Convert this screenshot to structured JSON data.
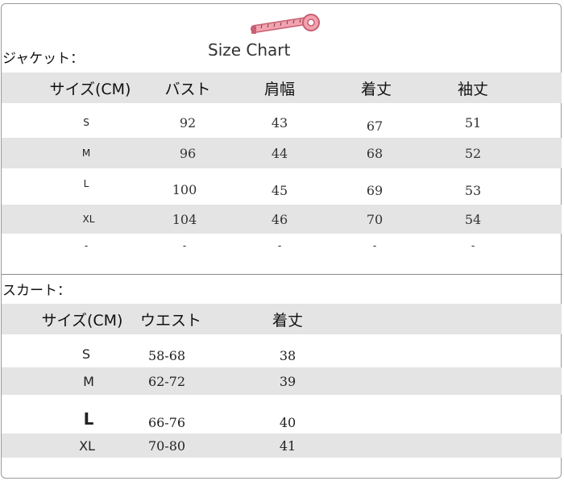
{
  "chart_title": "Size Chart",
  "jacket": {
    "label": "ジャケット：",
    "headers": [
      "サイズ(CM)",
      "バスト",
      "肩幅",
      "着丈",
      "袖丈"
    ],
    "rows": [
      [
        "S",
        "92",
        "43",
        "67",
        "51"
      ],
      [
        "M",
        "96",
        "44",
        "68",
        "52"
      ],
      [
        "L",
        "100",
        "45",
        "69",
        "53"
      ],
      [
        "XL",
        "104",
        "46",
        "70",
        "54"
      ],
      [
        "-",
        "-",
        "-",
        "-",
        "-"
      ]
    ]
  },
  "skirt": {
    "label": "スカート：",
    "headers": [
      "サイズ(CM)",
      "ウエスト",
      "着丈"
    ],
    "rows": [
      [
        "S",
        "58-68",
        "38"
      ],
      [
        "M",
        "62-72",
        "39"
      ],
      [
        "L",
        "66-76",
        "40"
      ],
      [
        "XL",
        "70-80",
        "41"
      ]
    ]
  },
  "colors": {
    "shade": "#e4e4e4",
    "tape": "#e58a9a"
  },
  "icons": {
    "tape": "measuring-tape-icon"
  }
}
